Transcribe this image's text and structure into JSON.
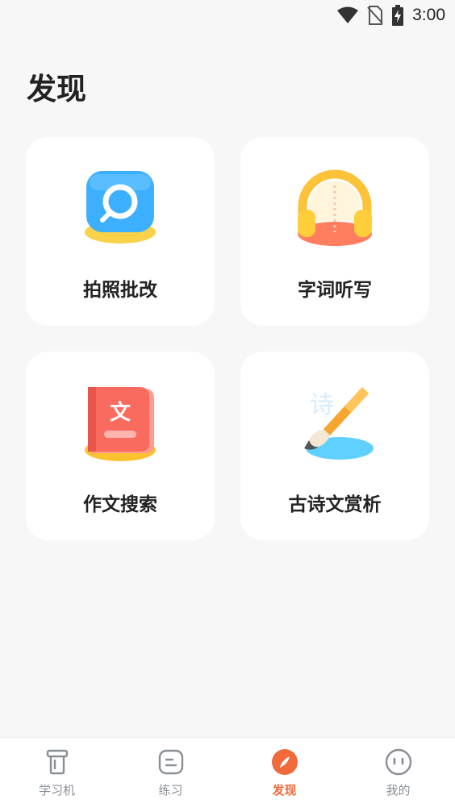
{
  "status_bar": {
    "time": "3:00",
    "icons": [
      "wifi-icon",
      "no-sim-icon",
      "battery-charging-icon"
    ]
  },
  "page": {
    "title": "发现"
  },
  "cards": [
    {
      "label": "拍照批改",
      "icon": "magnifier-camera-icon"
    },
    {
      "label": "字词听写",
      "icon": "headphones-icon"
    },
    {
      "label": "作文搜索",
      "icon": "book-wen-icon"
    },
    {
      "label": "古诗文赏析",
      "icon": "brush-icon"
    }
  ],
  "illustration_text": {
    "book_char": "文",
    "poem_char": "诗"
  },
  "tabbar": {
    "tabs": [
      {
        "label": "学习机",
        "icon": "learning-device-icon",
        "active": false
      },
      {
        "label": "练习",
        "icon": "practice-icon",
        "active": false
      },
      {
        "label": "发现",
        "icon": "discover-compass-icon",
        "active": true
      },
      {
        "label": "我的",
        "icon": "profile-face-icon",
        "active": false
      }
    ]
  },
  "colors": {
    "accent": "#f06a3c",
    "tab_inactive": "#8a8f96",
    "background": "#f7f7f7",
    "card": "#ffffff"
  }
}
